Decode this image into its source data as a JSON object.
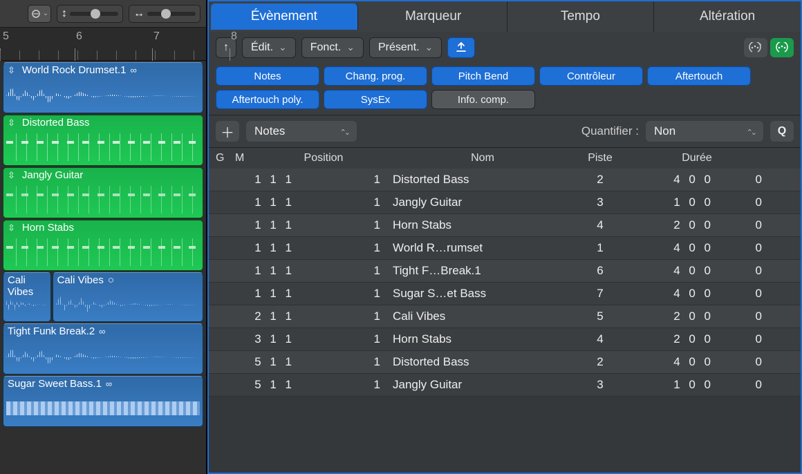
{
  "ruler": {
    "marks": [
      "5",
      "6",
      "7",
      "8"
    ]
  },
  "toolbar_left": {
    "menu_icon": "menu"
  },
  "tracks": [
    {
      "name": "World Rock Drumset.1",
      "color": "blue",
      "loop": true,
      "updown": true,
      "kind": "midi"
    },
    {
      "name": "Distorted Bass",
      "color": "green",
      "loop": false,
      "updown": true,
      "kind": "midi"
    },
    {
      "name": "Jangly Guitar",
      "color": "green",
      "loop": false,
      "updown": true,
      "kind": "midi"
    },
    {
      "name": "Horn Stabs",
      "color": "green",
      "loop": false,
      "updown": true,
      "kind": "midi"
    }
  ],
  "audio_row": {
    "a": {
      "name": "Cali Vibes"
    },
    "b": {
      "name": "Cali Vibes",
      "take": true
    }
  },
  "audio_tracks": [
    {
      "name": "Tight Funk Break.2",
      "loop": true
    },
    {
      "name": "Sugar Sweet Bass.1",
      "loop": true
    }
  ],
  "tabs": {
    "event": "Évènement",
    "marker": "Marqueur",
    "tempo": "Tempo",
    "alteration": "Altération"
  },
  "toolbar2": {
    "edit": "Édit.",
    "fonct": "Fonct.",
    "present": "Présent."
  },
  "filters": {
    "notes": "Notes",
    "progchange": "Chang. prog.",
    "pitchbend": "Pitch Bend",
    "controller": "Contrôleur",
    "aftertouch": "Aftertouch",
    "polyat": "Aftertouch poly.",
    "sysex": "SysEx",
    "info": "Info. comp."
  },
  "controls": {
    "type": "Notes",
    "quant_label": "Quantifier :",
    "quant_value": "Non",
    "q": "Q"
  },
  "columns": {
    "g": "G",
    "m": "M",
    "position": "Position",
    "nom": "Nom",
    "piste": "Piste",
    "duree": "Durée"
  },
  "events": [
    {
      "pos": "1 1 1",
      "sub": "1",
      "name": "Distorted Bass",
      "piste": "2",
      "dur": "4 0 0",
      "d2": "0"
    },
    {
      "pos": "1 1 1",
      "sub": "1",
      "name": "Jangly Guitar",
      "piste": "3",
      "dur": "1 0 0",
      "d2": "0"
    },
    {
      "pos": "1 1 1",
      "sub": "1",
      "name": "Horn Stabs",
      "piste": "4",
      "dur": "2 0 0",
      "d2": "0"
    },
    {
      "pos": "1 1 1",
      "sub": "1",
      "name": "World R…rumset",
      "piste": "1",
      "dur": "4 0 0",
      "d2": "0"
    },
    {
      "pos": "1 1 1",
      "sub": "1",
      "name": "Tight F…Break.1",
      "piste": "6",
      "dur": "4 0 0",
      "d2": "0"
    },
    {
      "pos": "1 1 1",
      "sub": "1",
      "name": "Sugar S…et Bass",
      "piste": "7",
      "dur": "4 0 0",
      "d2": "0"
    },
    {
      "pos": "2 1 1",
      "sub": "1",
      "name": "Cali Vibes",
      "piste": "5",
      "dur": "2 0 0",
      "d2": "0"
    },
    {
      "pos": "3 1 1",
      "sub": "1",
      "name": "Horn Stabs",
      "piste": "4",
      "dur": "2 0 0",
      "d2": "0"
    },
    {
      "pos": "5 1 1",
      "sub": "1",
      "name": "Distorted Bass",
      "piste": "2",
      "dur": "4 0 0",
      "d2": "0"
    },
    {
      "pos": "5 1 1",
      "sub": "1",
      "name": "Jangly Guitar",
      "piste": "3",
      "dur": "1 0 0",
      "d2": "0"
    }
  ]
}
